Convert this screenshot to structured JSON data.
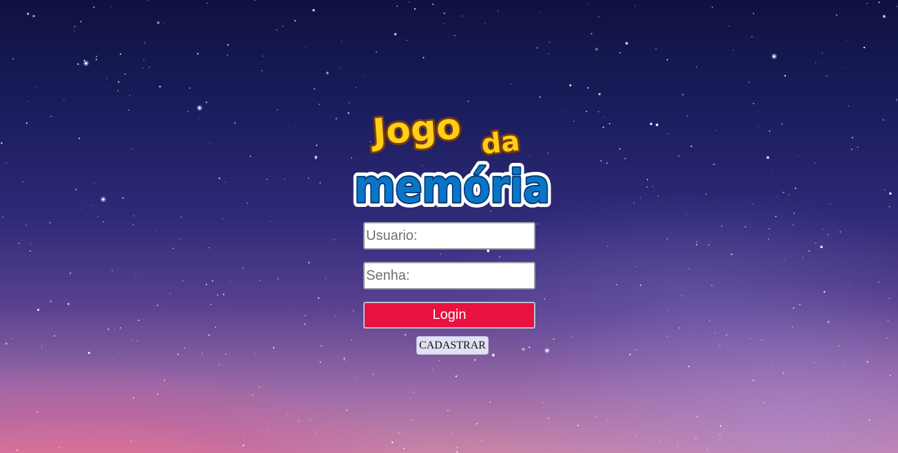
{
  "logo": {
    "line1_word1": "Jogo",
    "line1_word2": "da",
    "line2": "memória"
  },
  "form": {
    "username_placeholder": "Usuario:",
    "password_placeholder": "Senha:",
    "login_label": "Login",
    "register_label": "CADASTRAR"
  },
  "colors": {
    "login_button": "#e8113f",
    "logo_yellow": "#ffcf1a",
    "logo_blue": "#0a75c6"
  }
}
